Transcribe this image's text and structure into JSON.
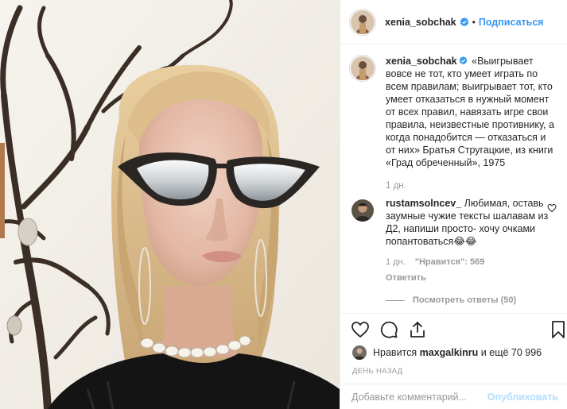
{
  "post": {
    "author": "xenia_sobchak",
    "separator": "•",
    "follow_label": "Подписаться"
  },
  "caption": {
    "username": "xenia_sobchak",
    "text": "«Выигрывает вовсе не тот, кто умеет играть по всем правилам; выигрывает тот, кто умеет отказаться в нужный момент от всех правил, навязать игре свои правила, неизвестные противнику, а когда понадобится — отказаться и от них» Братья Стругацкие, из книги «Град обреченный», 1975",
    "time": "1 дн."
  },
  "comment": {
    "username": "rustamsolncev_",
    "text": "Любимая, оставь заумные чужие тексты шалавам из Д2, напиши просто- хочу очками попантоваться😂😂",
    "time": "1 дн.",
    "likes": "\"Нравится\": 569",
    "reply_label": "Ответить",
    "view_replies": "Посмотреть ответы (50)"
  },
  "likes": {
    "prefix": "Нравится",
    "liker": "maxgalkinru",
    "suffix": "и ещё 70 996"
  },
  "timeago": "ДЕНЬ НАЗАД",
  "add_comment": {
    "placeholder": "Добавьте комментарий...",
    "publish_label": "Опубликовать"
  },
  "colors": {
    "link_blue": "#3897f0",
    "publish_disabled": "#b2dffc",
    "muted": "#999999",
    "border": "#efefef"
  },
  "icons": [
    "verified-badge-icon",
    "heart-icon",
    "comment-icon",
    "share-icon",
    "bookmark-icon"
  ]
}
